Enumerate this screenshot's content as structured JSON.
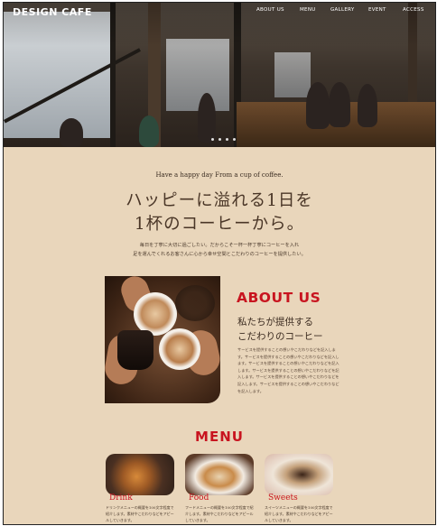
{
  "brand": {
    "logo": "DESIGN CAFE"
  },
  "nav": {
    "items": [
      "ABOUT US",
      "MENU",
      "GALLERY",
      "EVENT",
      "ACCESS"
    ]
  },
  "hero": {
    "slides": 4,
    "active_slide": 1
  },
  "intro": {
    "tagline": "Have a happy day From a cup of coffee.",
    "headline_line1": "ハッピーに溢れる1日を",
    "headline_line2": "1杯のコーヒーから。",
    "desc_line1": "毎日を丁寧に大切に過ごしたい。だからこそ一杯一杯丁寧にコーヒーを入れ",
    "desc_line2": "足を運んでくれるお客さんに心から幸せ空間とこだわりのコーヒーを提供したい。"
  },
  "about": {
    "title": "ABOUT US",
    "subtitle_line1": "私たちが提供する",
    "subtitle_line2": "こだわりのコーヒー",
    "text": "サービスを提供することの想いやこだわりなどを記入します。サービスを提供することの想いやこだわりなどを記入します。サービスを提供することの想いやこだわりなどを記入します。サービスを提供することの想いやこだわりなどを記入します。サービスを提供することの想いやこだわりなどを記入します。サービスを提供することの想いやこだわりなどを記入します。"
  },
  "menu": {
    "title": "MENU",
    "items": [
      {
        "name": "Drink",
        "text": "ドリンクメニューの概要を100文字程度で紹介します。素材やこだわりなどをアピールしていきます。"
      },
      {
        "name": "Food",
        "text": "フードメニューの概要を100文字程度で紹介します。素材やこだわりなどをアピールしていきます。"
      },
      {
        "name": "Sweets",
        "text": "スイーツメニューの概要を100文字程度で紹介します。素材やこだわりなどをアピールしていきます。"
      }
    ]
  },
  "colors": {
    "accent": "#c8141f",
    "background": "#e9d6bb",
    "text": "#4a3627"
  }
}
